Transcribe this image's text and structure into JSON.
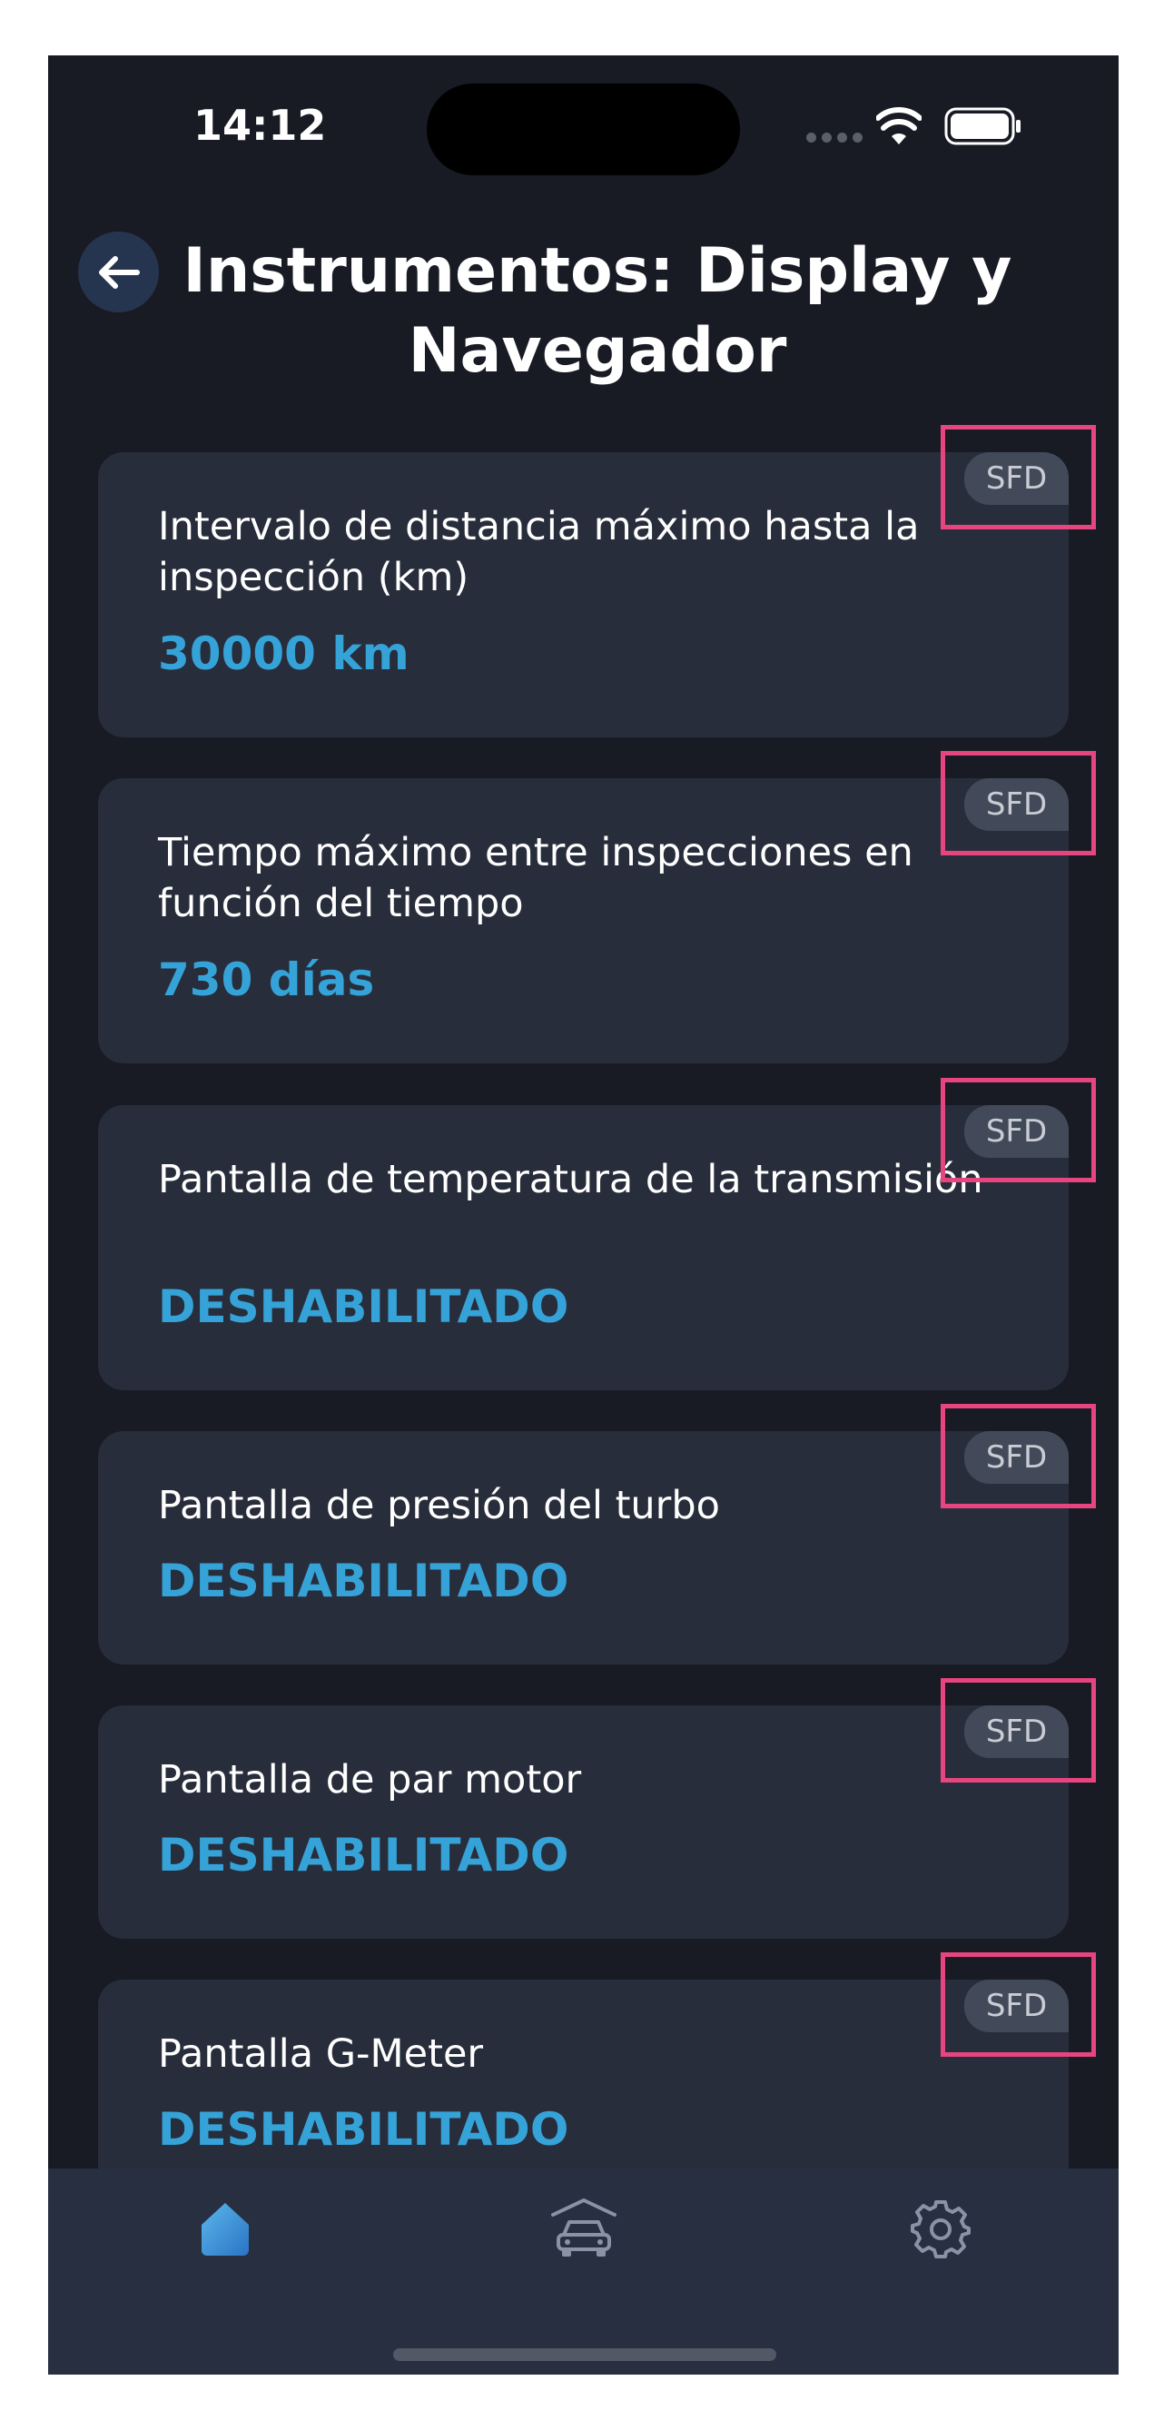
{
  "status_bar": {
    "time": "14:12"
  },
  "header": {
    "title": "Instrumentos: Display y Navegador"
  },
  "settings": [
    {
      "label": "Intervalo de distancia máximo hasta la inspección (km)",
      "value": "30000 km",
      "badge": "SFD"
    },
    {
      "label": "Tiempo máximo entre inspecciones en función del tiempo",
      "value": "730 días",
      "badge": "SFD"
    },
    {
      "label": "Pantalla de temperatura de la transmisión",
      "value": "DESHABILITADO",
      "badge": "SFD"
    },
    {
      "label": "Pantalla de presión del turbo",
      "value": "DESHABILITADO",
      "badge": "SFD"
    },
    {
      "label": "Pantalla de par motor",
      "value": "DESHABILITADO",
      "badge": "SFD"
    },
    {
      "label": "Pantalla G-Meter",
      "value": "DESHABILITADO",
      "badge": "SFD"
    }
  ],
  "bottom_nav": {
    "items": [
      {
        "icon": "home-icon",
        "active": true
      },
      {
        "icon": "car-garage-icon",
        "active": false
      },
      {
        "icon": "gear-icon",
        "active": false
      }
    ]
  },
  "colors": {
    "background": "#181b24",
    "card": "#282d3b",
    "accent": "#35a3d8",
    "highlight": "#e7457f",
    "badge": "#424a59"
  }
}
